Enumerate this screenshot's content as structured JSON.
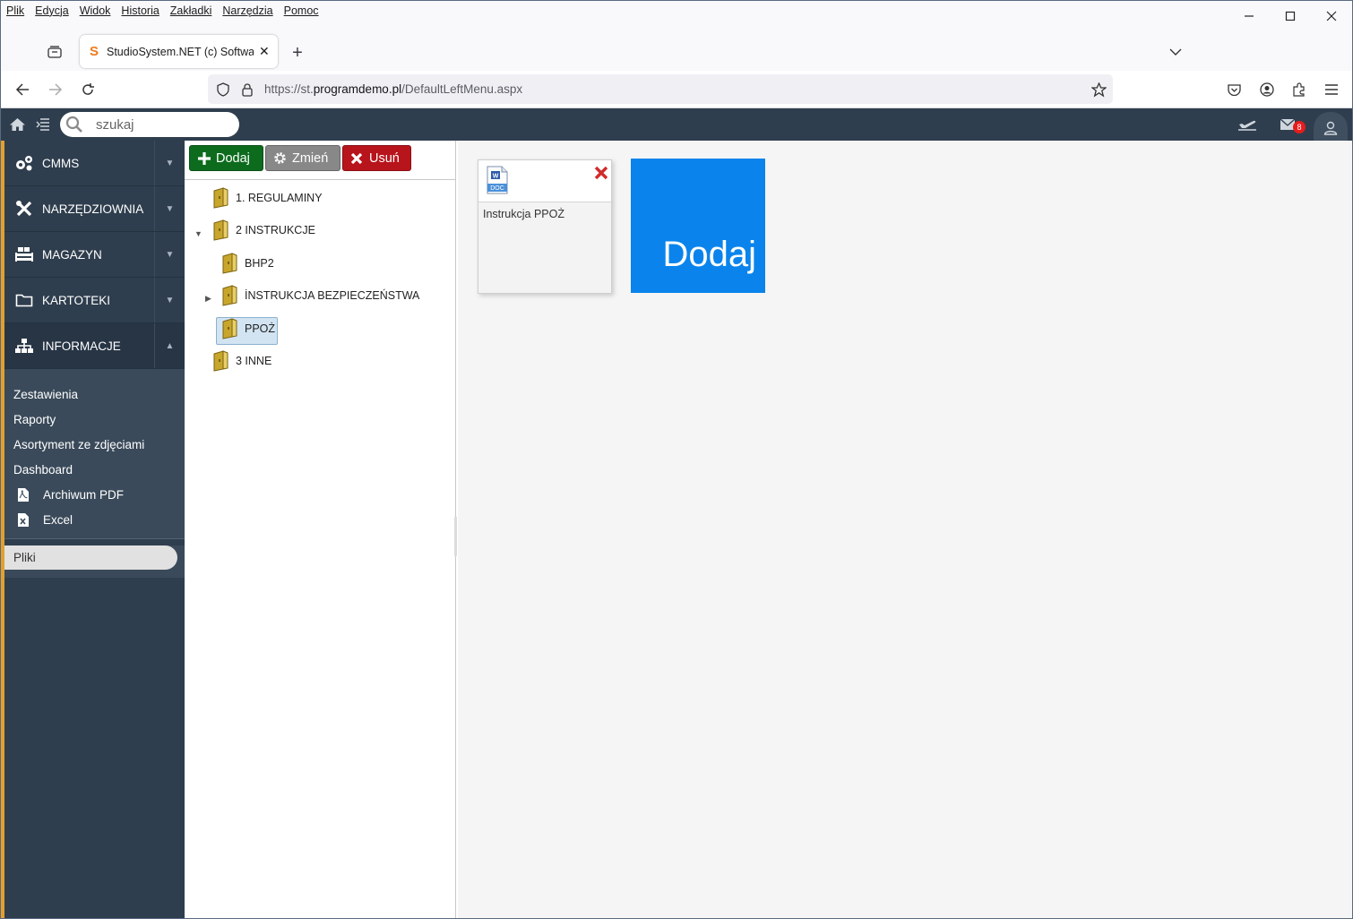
{
  "browser": {
    "menu": [
      "Plik",
      "Edycja",
      "Widok",
      "Historia",
      "Zakładki",
      "Narzędzia",
      "Pomoc"
    ],
    "tab_title": "StudioSystem.NET (c) Software",
    "url_prefix": "https://st.",
    "url_domain": "programdemo.pl",
    "url_path": "/DefaultLeftMenu.aspx",
    "new_tab": "+",
    "close_tab": "✕"
  },
  "app": {
    "search_placeholder": "szukaj",
    "mail_count": "8"
  },
  "sidebar": {
    "items": [
      {
        "label": "CMMS",
        "icon": "gears-icon"
      },
      {
        "label": "NARZĘDZIOWNIA",
        "icon": "tools-icon"
      },
      {
        "label": "MAGAZYN",
        "icon": "warehouse-icon"
      },
      {
        "label": "KARTOTEKI",
        "icon": "folder-icon"
      },
      {
        "label": "INFORMACJE",
        "icon": "sitemap-icon"
      }
    ],
    "submenu": [
      "Zestawienia",
      "Raporty",
      "Asortyment ze zdjęciami",
      "Dashboard"
    ],
    "submenu_icons": [
      {
        "label": "Archiwum PDF",
        "icon": "pdf-file-icon"
      },
      {
        "label": "Excel",
        "icon": "excel-file-icon"
      }
    ],
    "active_item": "Pliki"
  },
  "toolbar": {
    "add_label": "Dodaj",
    "edit_label": "Zmień",
    "delete_label": "Usuń",
    "add_color": "#0d6b1e",
    "edit_color": "#888888",
    "delete_color": "#b8141b"
  },
  "tree": {
    "nodes": [
      {
        "label": "1. REGULAMINY"
      },
      {
        "label": "2 INSTRUKCJE",
        "expanded": true
      },
      {
        "label": "BHP2"
      },
      {
        "label": "İNSTRUKCJA BEZPIECZEŃSTWA",
        "collapsed": true
      },
      {
        "label": "PPOŻ",
        "selected": true
      },
      {
        "label": "3 INNE"
      }
    ]
  },
  "content": {
    "file_label": "Instrukcja PPOŻ",
    "file_icon": "word-doc-icon",
    "file_type_text": "DOC",
    "add_tile": "Dodaj",
    "add_tile_color": "#0a84ec"
  }
}
